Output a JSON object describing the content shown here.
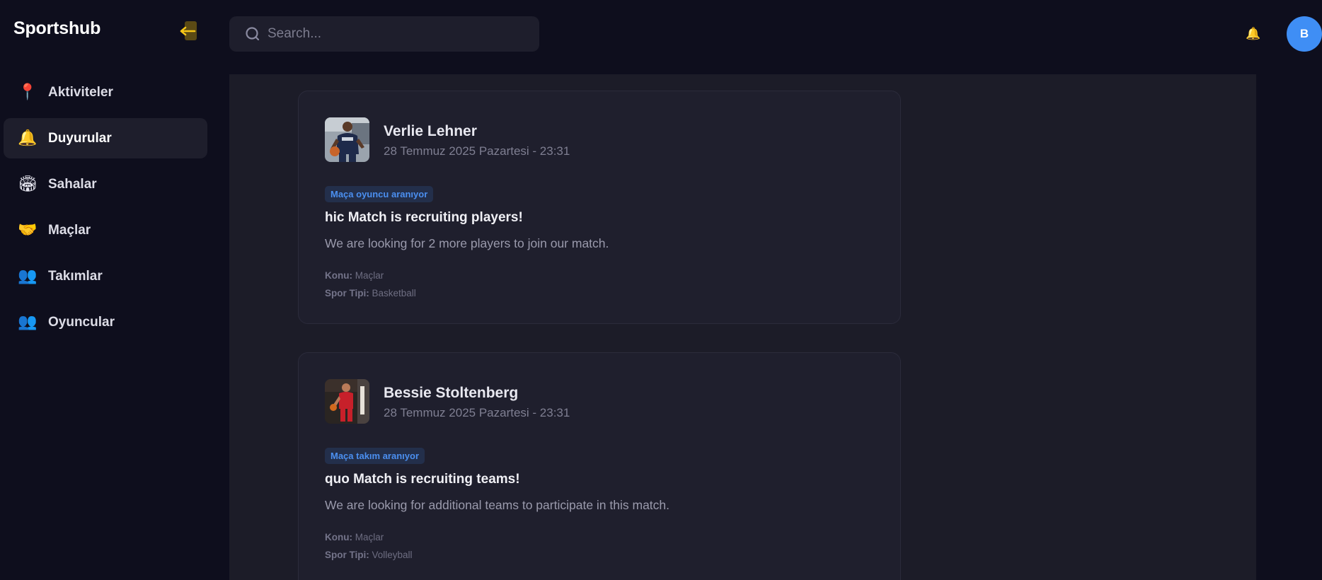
{
  "app": {
    "brand": "Sportshub"
  },
  "sidebar": {
    "items": [
      {
        "label": "Aktiviteler",
        "icon": "📍",
        "icon_name": "pin-icon"
      },
      {
        "label": "Duyurular",
        "icon": "🔔",
        "icon_name": "bell-icon",
        "active": true
      },
      {
        "label": "Sahalar",
        "icon": "🏟",
        "icon_name": "stadium-icon"
      },
      {
        "label": "Maçlar",
        "icon": "🤝",
        "icon_name": "handshake-icon"
      },
      {
        "label": "Takımlar",
        "icon": "👥",
        "icon_name": "people-icon"
      },
      {
        "label": "Oyuncular",
        "icon": "👥",
        "icon_name": "people-icon"
      }
    ]
  },
  "header": {
    "search_placeholder": "Search...",
    "notification_icon": "🔔",
    "avatar_initial": "B",
    "avatar_color": "#3f8ef5"
  },
  "posts": [
    {
      "author": "Verlie Lehner",
      "date": "28 Temmuz 2025 Pazartesi - 23:31",
      "tag": "Maça oyuncu aranıyor",
      "title": "hic Match is recruiting players!",
      "body": "We are looking for 2 more players to join our match.",
      "topic_label": "Konu:",
      "topic": "Maçlar",
      "sport_label": "Spor Tipi:",
      "sport": "Basketball"
    },
    {
      "author": "Bessie Stoltenberg",
      "date": "28 Temmuz 2025 Pazartesi - 23:31",
      "tag": "Maça takım aranıyor",
      "title": "quo Match is recruiting teams!",
      "body": "We are looking for additional teams to participate in this match.",
      "topic_label": "Konu:",
      "topic": "Maçlar",
      "sport_label": "Spor Tipi:",
      "sport": "Volleyball"
    }
  ],
  "colors": {
    "background": "#0e0e1d",
    "panel": "#1c1c28",
    "accent": "#4b8ff0",
    "brand_icon": "#f5c518"
  }
}
